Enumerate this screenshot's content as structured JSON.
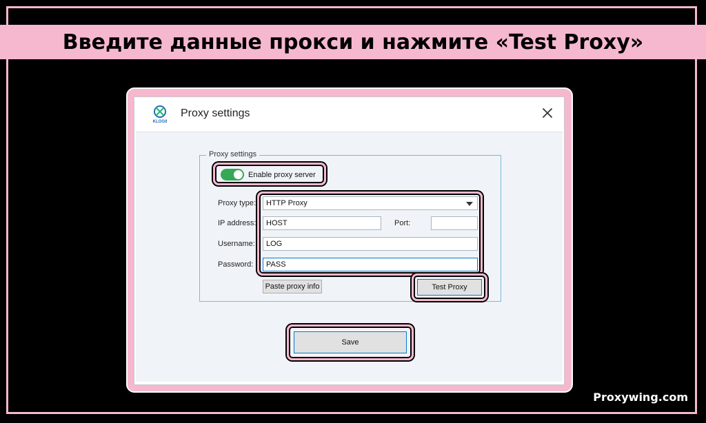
{
  "banner": {
    "title": "Введите данные прокси и нажмите «Test Proxy»"
  },
  "watermark": {
    "text": "Proxywing.com"
  },
  "window": {
    "title": "Proxy settings",
    "logo_text": "KLOGII",
    "close_icon": "close-icon"
  },
  "proxy_settings": {
    "group_label": "Proxy settings",
    "enable_toggle": {
      "label": "Enable proxy server",
      "on": true
    },
    "proxy_type": {
      "label": "Proxy type:",
      "value": "HTTP Proxy"
    },
    "ip_address": {
      "label": "IP address:",
      "value": "HOST"
    },
    "port": {
      "label": "Port:",
      "value": ""
    },
    "username": {
      "label": "Username:",
      "value": "LOG"
    },
    "password": {
      "label": "Password:",
      "value": "PASS"
    },
    "paste_button": "Paste proxy info",
    "test_button": "Test Proxy"
  },
  "footer": {
    "save_button": "Save"
  },
  "colors": {
    "highlight": "#f6b8cf",
    "toggle_on": "#34a853",
    "group_border": "#7ab8d9",
    "focus": "#0078d7"
  }
}
